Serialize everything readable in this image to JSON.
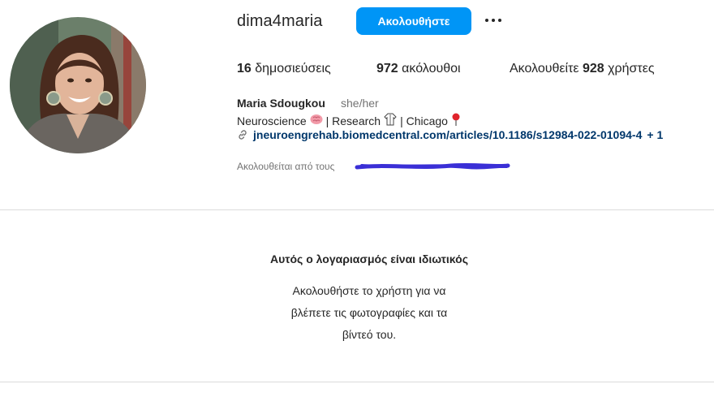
{
  "profile": {
    "username": "dima4maria",
    "follow_label": "Ακολουθήστε",
    "more_icon": "more-horizontal-icon",
    "stats": {
      "posts_count": "16",
      "posts_label": "δημοσιεύσεις",
      "followers_count": "972",
      "followers_label": "ακόλουθοι",
      "following_prefix": "Ακολουθείτε",
      "following_count": "928",
      "following_suffix": "χρήστες"
    },
    "full_name": "Maria Sdougkou",
    "pronouns": "she/her",
    "bio": {
      "part1": "Neuroscience",
      "icon1": "brain-icon",
      "part2": "| Research",
      "icon2": "lab-coat-icon",
      "part3": "| Chicago",
      "icon3": "pin-icon"
    },
    "link": {
      "text": "jneuroengrehab.biomedcentral.com/articles/10.1186/s12984-022-01094-4",
      "extra": "+ 1",
      "icon": "link-icon"
    },
    "followed_by": "Ακολουθείται από τους"
  },
  "private": {
    "title": "Αυτός ο λογαριασμός είναι ιδιωτικός",
    "line1": "Ακολουθήστε το χρήστη για να",
    "line2": "βλέπετε τις φωτογραφίες και τα",
    "line3": "βίντεό του."
  },
  "colors": {
    "accent": "#0095f6",
    "link": "#00376b",
    "muted": "#737373",
    "scribble": "#3a2fd6"
  }
}
